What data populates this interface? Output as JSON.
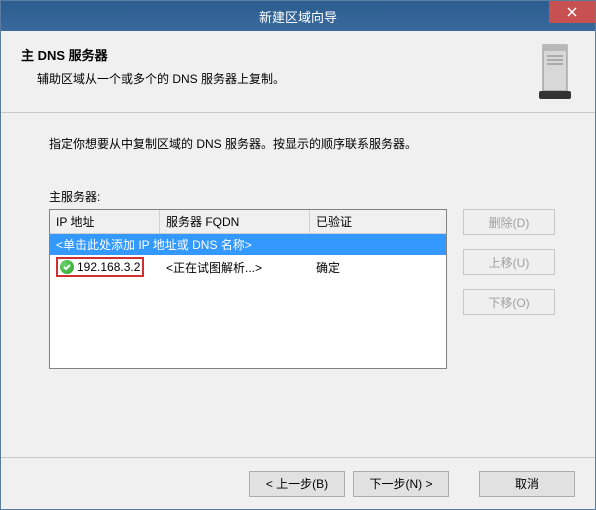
{
  "titlebar": {
    "title": "新建区域向导"
  },
  "header": {
    "title": "主 DNS 服务器",
    "subtitle": "辅助区域从一个或多个的 DNS 服务器上复制。"
  },
  "content": {
    "instruction": "指定你想要从中复制区域的 DNS 服务器。按显示的顺序联系服务器。",
    "label": "主服务器:",
    "columns": {
      "ip": "IP 地址",
      "fqdn": "服务器 FQDN",
      "validated": "已验证"
    },
    "placeholder_row": "<单击此处添加 IP 地址或 DNS 名称>",
    "rows": [
      {
        "ip": "192.168.3.2",
        "fqdn": "<正在试图解析...>",
        "validated": "确定",
        "status": "ok"
      }
    ]
  },
  "side": {
    "delete": "删除(D)",
    "moveup": "上移(U)",
    "movedown": "下移(O)"
  },
  "footer": {
    "back": "< 上一步(B)",
    "next": "下一步(N) >",
    "cancel": "取消"
  }
}
